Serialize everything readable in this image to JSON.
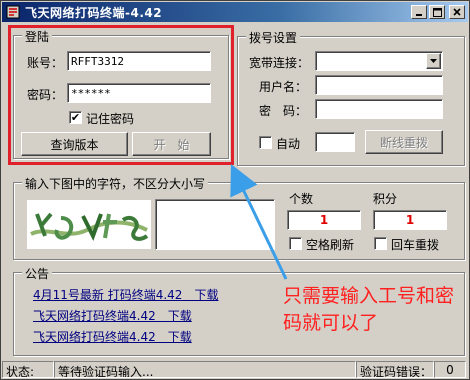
{
  "window": {
    "title": "飞天网络打码终端-4.42"
  },
  "login": {
    "group_title": "登陆",
    "account_label": "账号：",
    "account_value": "RFFT3312",
    "password_label": "密码：",
    "password_value": "******",
    "remember_label": "记住密码",
    "remember_checked": "✔",
    "query_button": "查询版本",
    "start_button": "开　始"
  },
  "dial": {
    "group_title": "拨号设置",
    "broadband_label": "宽带连接：",
    "username_label": "用户名：",
    "password_label": "密　码：",
    "auto_label": "自动",
    "reconnect_button": "断线重拨"
  },
  "captcha": {
    "group_title": "输入下图中的字符，不区分大小写",
    "count_label": "个数",
    "count_value": "1",
    "score_label": "积分",
    "score_value": "1",
    "space_refresh_label": "空格刷新",
    "enter_redial_label": "回车重拨"
  },
  "announcement": {
    "group_title": "公告",
    "links": [
      "4月11号最新 打码终端4.42　下载",
      "飞天网络打码终端4.42　下载",
      "飞天网络打码终端4.42　下载"
    ]
  },
  "annotation": {
    "text": "只需要输入工号和密码就可以了"
  },
  "status": {
    "label": "状态:",
    "message": "等待验证码输入...",
    "error_label": "验证码错误：",
    "error_value": "0"
  },
  "colors": {
    "highlight": "#e0202a",
    "annotation_text": "#ff2020",
    "arrow": "#3a9ee8",
    "title_bar": "#0a246a"
  }
}
